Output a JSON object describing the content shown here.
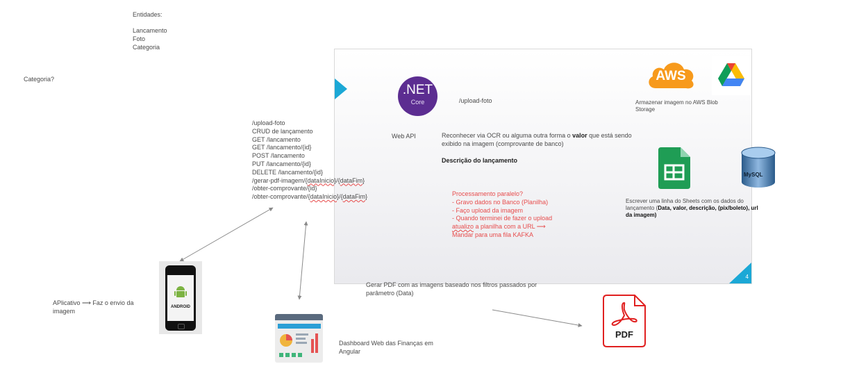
{
  "entities": {
    "title": "Entidades:",
    "items": [
      "Lancamento",
      "Foto",
      "Categoria"
    ]
  },
  "category_question": "Categoria?",
  "slide": {
    "page_number": "4",
    "dotnet": {
      "top": ".NET",
      "bottom": "Core"
    },
    "web_api_label": "Web API",
    "upload_foto_label": "/upload-foto",
    "aws_label": "AWS",
    "aws_caption": "Armazenar imagem no AWS Blob Storage",
    "ocr_text_before": "Reconhecer via OCR ou alguma outra forma o ",
    "ocr_text_bold": "valor",
    "ocr_text_after": " que está sendo exibido na imagem (comprovante de banco)",
    "description_title": "Descrição do lançamento",
    "sheets_caption_plain": "Escrever uma linha do Sheets com os dados do lançamento (",
    "sheets_caption_bold": "Data, valor, descrição, (pix/boleto), url da imagem)",
    "mysql_label": "MySQL",
    "parallel": {
      "line1": "Processamento paralelo?",
      "line2_pre": "- Gravo dados no Banco (Planilha)",
      "line3": "- Faço upload da imagem",
      "line4": "- Quando terminei de fazer o upload",
      "line5_under": "atualizo",
      "line5_rest": " a planilha com a URL ⟶",
      "line6": "Mandar para uma fila KAFKA"
    }
  },
  "endpoints": {
    "items": [
      "/upload-foto",
      "CRUD de lançamento",
      "GET /lancamento",
      "GET /lancamento/{id}",
      "POST /lancamento",
      "PUT /lancamento/{id}",
      "DELETE  /lancamento/{id}"
    ],
    "pdf_pre": "/gerar-pdf-imagem/{",
    "pdf_a": "dataInicio",
    "pdf_mid": "}/{",
    "pdf_b": "dataFim",
    "pdf_end": "}",
    "comp1": "/obter-comprovante/{id}",
    "comp2_pre": "/obter-comprovante/{",
    "comp2_a": "dataInicio",
    "comp2_mid": "}/{",
    "comp2_b": "dataFim",
    "comp2_end": "}"
  },
  "app_caption": "APlicativo ⟶ Faz o envio da imagem",
  "android_label": "ANDROID",
  "dashboard_caption": "Dashboard Web das Finanças em Angular",
  "pdf_caption": "Gerar PDF com as imagens baseado nos filtros passados por parâmetro (Data)",
  "pdf_icon_label": "PDF",
  "colors": {
    "dotnet_purple": "#5c2d91",
    "aws_orange": "#f79a1c",
    "sheets_green": "#1f9d55",
    "pdf_red": "#e02020",
    "accent_cyan": "#1ba8d6",
    "note_red": "#e74c4c"
  }
}
